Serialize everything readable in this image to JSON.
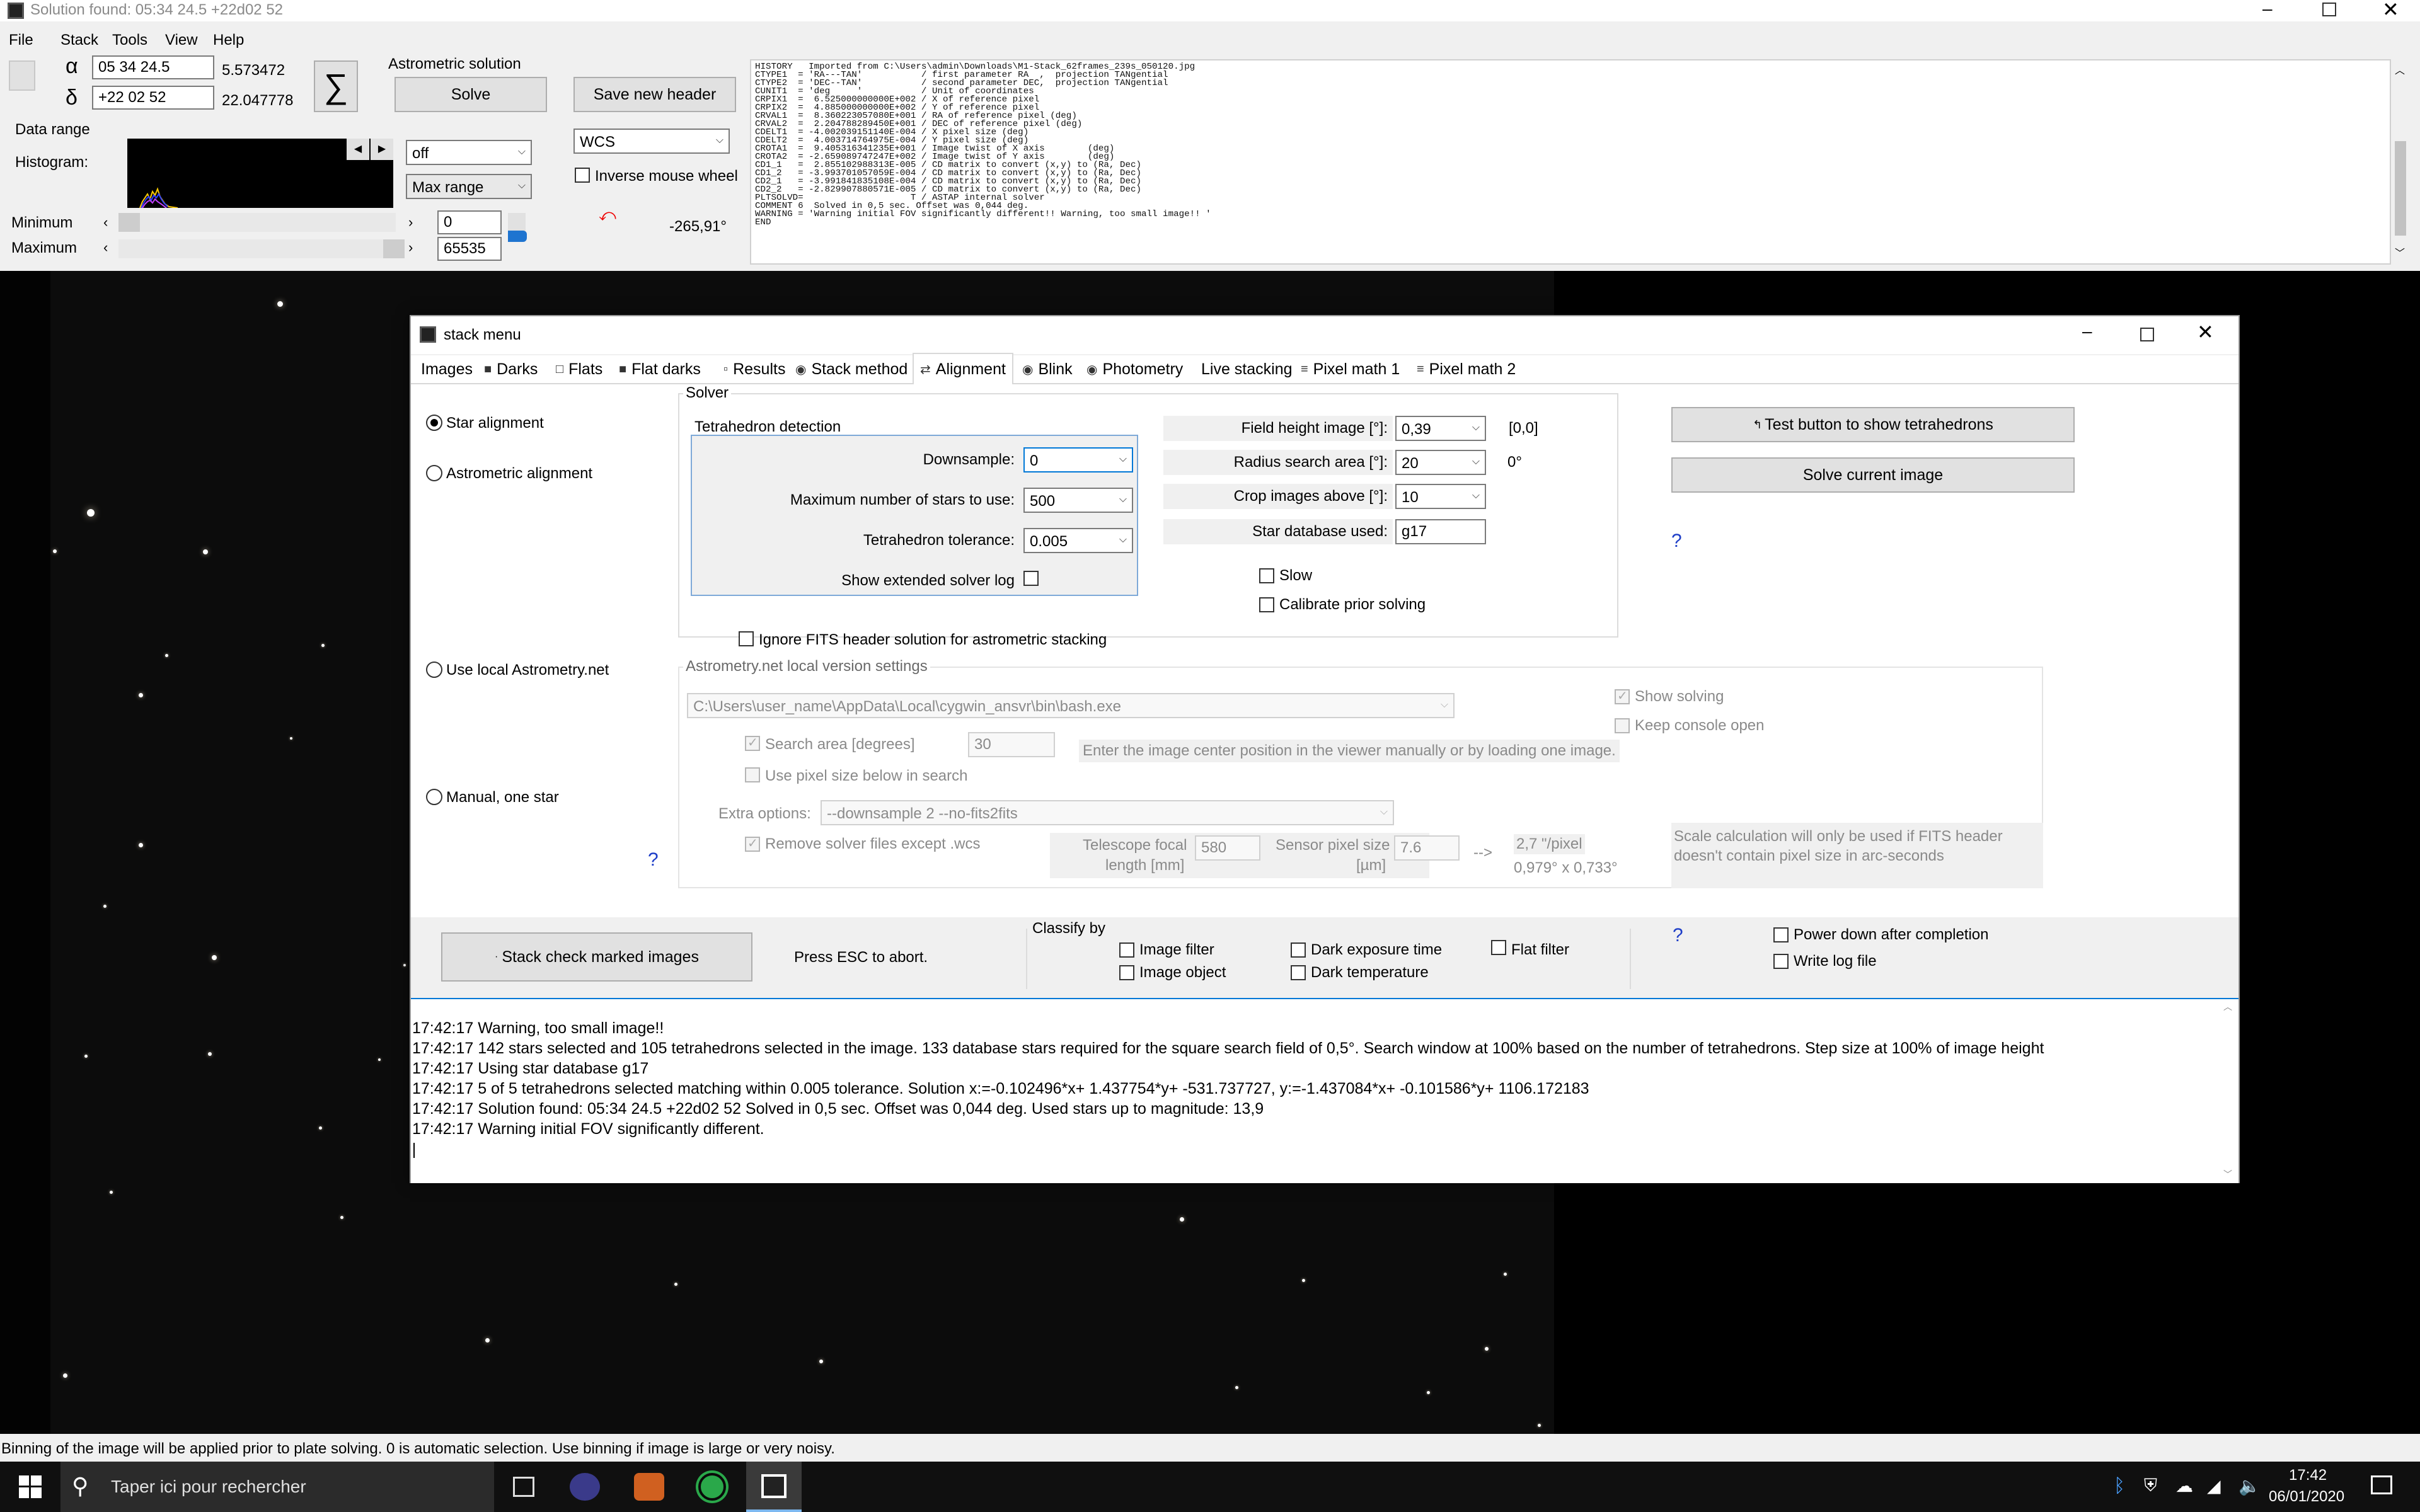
{
  "main_window": {
    "title": "Solution found:    05:34 24.5      +22d02 52",
    "menu": [
      "File",
      "Stack",
      "Tools",
      "View",
      "Help"
    ],
    "alpha_symbol": "α",
    "delta_symbol": "δ",
    "ra_value": "05 34 24.5",
    "ra_decimal": "5.573472",
    "dec_value": "+22 02 52",
    "dec_decimal": "22.047778",
    "sigma_symbol": "∑",
    "astrometric_label": "Astrometric solution",
    "solve_button": "Solve",
    "save_header_button": "Save new header",
    "data_range_label": "Data range",
    "histogram_label": "Histogram:",
    "range_combo": "off",
    "max_range_combo": "Max range",
    "wcs_combo": "WCS",
    "inverse_mouse_label": "Inverse mouse wheel",
    "angle_value": "-265,91°",
    "minimum_label": "Minimum",
    "maximum_label": "Maximum",
    "minimum_value": "0",
    "maximum_value": "65535",
    "header_text": [
      "HISTORY   Imported from C:\\Users\\admin\\Downloads\\M1-Stack_62frames_239s_050120.jpg",
      "CTYPE1  = 'RA---TAN'           / first parameter RA  ,  projection TANgential",
      "CTYPE2  = 'DEC--TAN'           / second parameter DEC,  projection TANgential",
      "CUNIT1  = 'deg     '           / Unit of coordinates",
      "CRPIX1  =  6.525000000000E+002 / X of reference pixel",
      "CRPIX2  =  4.885000000000E+002 / Y of reference pixel",
      "CRVAL1  =  8.360223057080E+001 / RA of reference pixel (deg)",
      "CRVAL2  =  2.204788289450E+001 / DEC of reference pixel (deg)",
      "CDELT1  = -4.002039151140E-004 / X pixel size (deg)",
      "CDELT2  =  4.003714764975E-004 / Y pixel size (deg)",
      "CROTA1  =  9.405316341235E+001 / Image twist of X axis        (deg)",
      "CROTA2  = -2.659089747247E+002 / Image twist of Y axis        (deg)",
      "CD1_1   =  2.855102988313E-005 / CD matrix to convert (x,y) to (Ra, Dec)",
      "CD1_2   = -3.993701057059E-004 / CD matrix to convert (x,y) to (Ra, Dec)",
      "CD2_1   = -3.991841835108E-004 / CD matrix to convert (x,y) to (Ra, Dec)",
      "CD2_2   = -2.829907880571E-005 / CD matrix to convert (x,y) to (Ra, Dec)",
      "PLTSOLVD=                    T / ASTAP internal solver",
      "COMMENT 6  Solved in 0,5 sec. Offset was 0,044 deg.",
      "WARNING = 'Warning initial FOV significantly different!! Warning, too small image!! '",
      "END"
    ]
  },
  "stack_menu": {
    "title": "stack menu",
    "tabs": [
      "Images",
      "Darks",
      "Flats",
      "Flat darks",
      "Results",
      "Stack method",
      "Alignment",
      "Blink",
      "Photometry",
      "Live stacking",
      "Pixel math 1",
      "Pixel math 2"
    ],
    "active_tab": "Alignment",
    "radios": {
      "star_alignment": "Star alignment",
      "astrometric_alignment": "Astrometric alignment",
      "local_astrometry": "Use local Astrometry.net",
      "manual_one_star": "Manual, one star"
    },
    "solver_label": "Solver",
    "tetrahedron_label": "Tetrahedron detection",
    "downsample_label": "Downsample:",
    "downsample_value": "0",
    "max_stars_label": "Maximum number of stars to use:",
    "max_stars_value": "500",
    "tolerance_label": "Tetrahedron tolerance:",
    "tolerance_value": "0.005",
    "show_log_label": "Show extended solver log",
    "field_height_label": "Field height image [°]:",
    "field_height_value": "0,39",
    "field_height_extra": "[0,0]",
    "radius_label": "Radius search area  [°]:",
    "radius_value": "20",
    "radius_extra": "0°",
    "crop_label": "Crop images above [°]:",
    "crop_value": "10",
    "star_db_label": "Star database used:",
    "star_db_value": "g17",
    "slow_label": "Slow",
    "calibrate_label": "Calibrate prior solving",
    "test_button": "Test button to show tetrahedrons",
    "solve_current_button": "Solve current image",
    "help_mark": "?",
    "ignore_fits_label": "Ignore FITS header solution for astrometric stacking",
    "astrometry_settings_label": "Astrometry.net local version settings",
    "bash_path": "C:\\Users\\user_name\\AppData\\Local\\cygwin_ansvr\\bin\\bash.exe",
    "show_solving_label": "Show solving",
    "keep_console_label": "Keep console open",
    "search_area_label": "Search area [degrees]",
    "search_area_value": "30",
    "center_hint": "Enter the image center position in the viewer manually or by loading one image.",
    "pixel_size_label": "Use pixel size below in search",
    "extra_options_label": "Extra options:",
    "extra_options_value": "--downsample 2 --no-fits2fits",
    "remove_files_label": "Remove solver files except .wcs",
    "focal_label_1": "Telescope focal",
    "focal_label_2": "length [mm]",
    "focal_value": "580",
    "sensor_label_1": "Sensor pixel size",
    "sensor_label_2": "[µm]",
    "sensor_value": "7.6",
    "arrow_text": "-->",
    "scale_1": "2,7 \"/pixel",
    "scale_2": "0,979° x 0,733°",
    "scale_note": "Scale calculation will only be used if FITS header doesn't contain pixel size in arc-seconds",
    "stack_button": "Stack check marked images",
    "esc_label": "Press ESC to abort.",
    "classify_label": "Classify by",
    "image_filter_label": "Image filter",
    "image_object_label": "Image object",
    "dark_exposure_label": "Dark exposure time",
    "dark_temp_label": "Dark temperature",
    "flat_filter_label": "Flat filter",
    "power_down_label": "Power down after completion",
    "write_log_label": "Write log file",
    "log": [
      "17:42:17  Warning, too small image!!",
      "17:42:17  142 stars selected and 105 tetrahedrons selected in the image. 133 database stars required for the square search field of 0,5°. Search window at 100% based on the number of tetrahedrons. Step size at 100% of image height",
      "17:42:17  Using star database g17",
      "17:42:17  5 of 5 tetrahedrons selected matching within 0.005 tolerance.  Solution x:=-0.102496*x+ 1.437754*y+ -531.737727,  y:=-1.437084*x+ -0.101586*y+ 1106.172183",
      "17:42:17  Solution found: 05:34 24.5     +22d02 52             Solved in 0,5 sec. Offset was 0,044 deg.             Used stars up to magnitude: 13,9",
      "17:42:17  Warning initial FOV significantly different."
    ]
  },
  "status_bar": "Binning of the image will be applied prior to plate solving. 0 is automatic selection. Use binning if image is large or very noisy.",
  "taskbar": {
    "search_placeholder": "Taper ici pour rechercher",
    "time": "17:42",
    "date": "06/01/2020"
  },
  "colors": {
    "accent": "#0078d7",
    "taskbar": "#101010",
    "image_bg": "#0c0c0c"
  }
}
